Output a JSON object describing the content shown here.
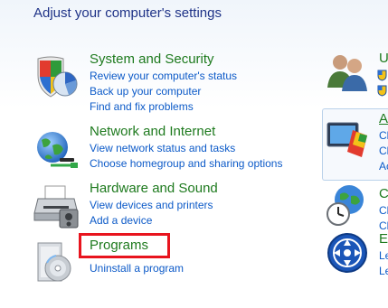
{
  "page_title": "Adjust your computer's settings",
  "categories": [
    {
      "title": "System and Security",
      "icon": "system-security-icon",
      "links": [
        "Review your computer's status",
        "Back up your computer",
        "Find and fix problems"
      ]
    },
    {
      "title": "Network and Internet",
      "icon": "network-globe-icon",
      "links": [
        "View network status and tasks",
        "Choose homegroup and sharing options"
      ]
    },
    {
      "title": "Hardware and Sound",
      "icon": "printer-icon",
      "links": [
        "View devices and printers",
        "Add a device"
      ]
    },
    {
      "title": "Programs",
      "icon": "programs-disc-icon",
      "links": [
        "Uninstall a program"
      ]
    }
  ],
  "right_column": [
    {
      "title": "U",
      "icon": "user-accounts-icon",
      "links": [
        "",
        ""
      ]
    },
    {
      "title": "A",
      "icon": "appearance-icon",
      "links": [
        "Cl",
        "Cl",
        "Ac"
      ]
    },
    {
      "title": "C",
      "icon": "clock-globe-icon",
      "links": [
        "Cl",
        "Cl"
      ]
    },
    {
      "title": "Ea",
      "icon": "ease-of-access-icon",
      "links": [
        "Le",
        "Le"
      ]
    }
  ],
  "colors": {
    "title_blue": "#1e3287",
    "category_green": "#1e7a1e",
    "link_blue": "#0c5ac8",
    "highlight_red": "#e8141e"
  }
}
